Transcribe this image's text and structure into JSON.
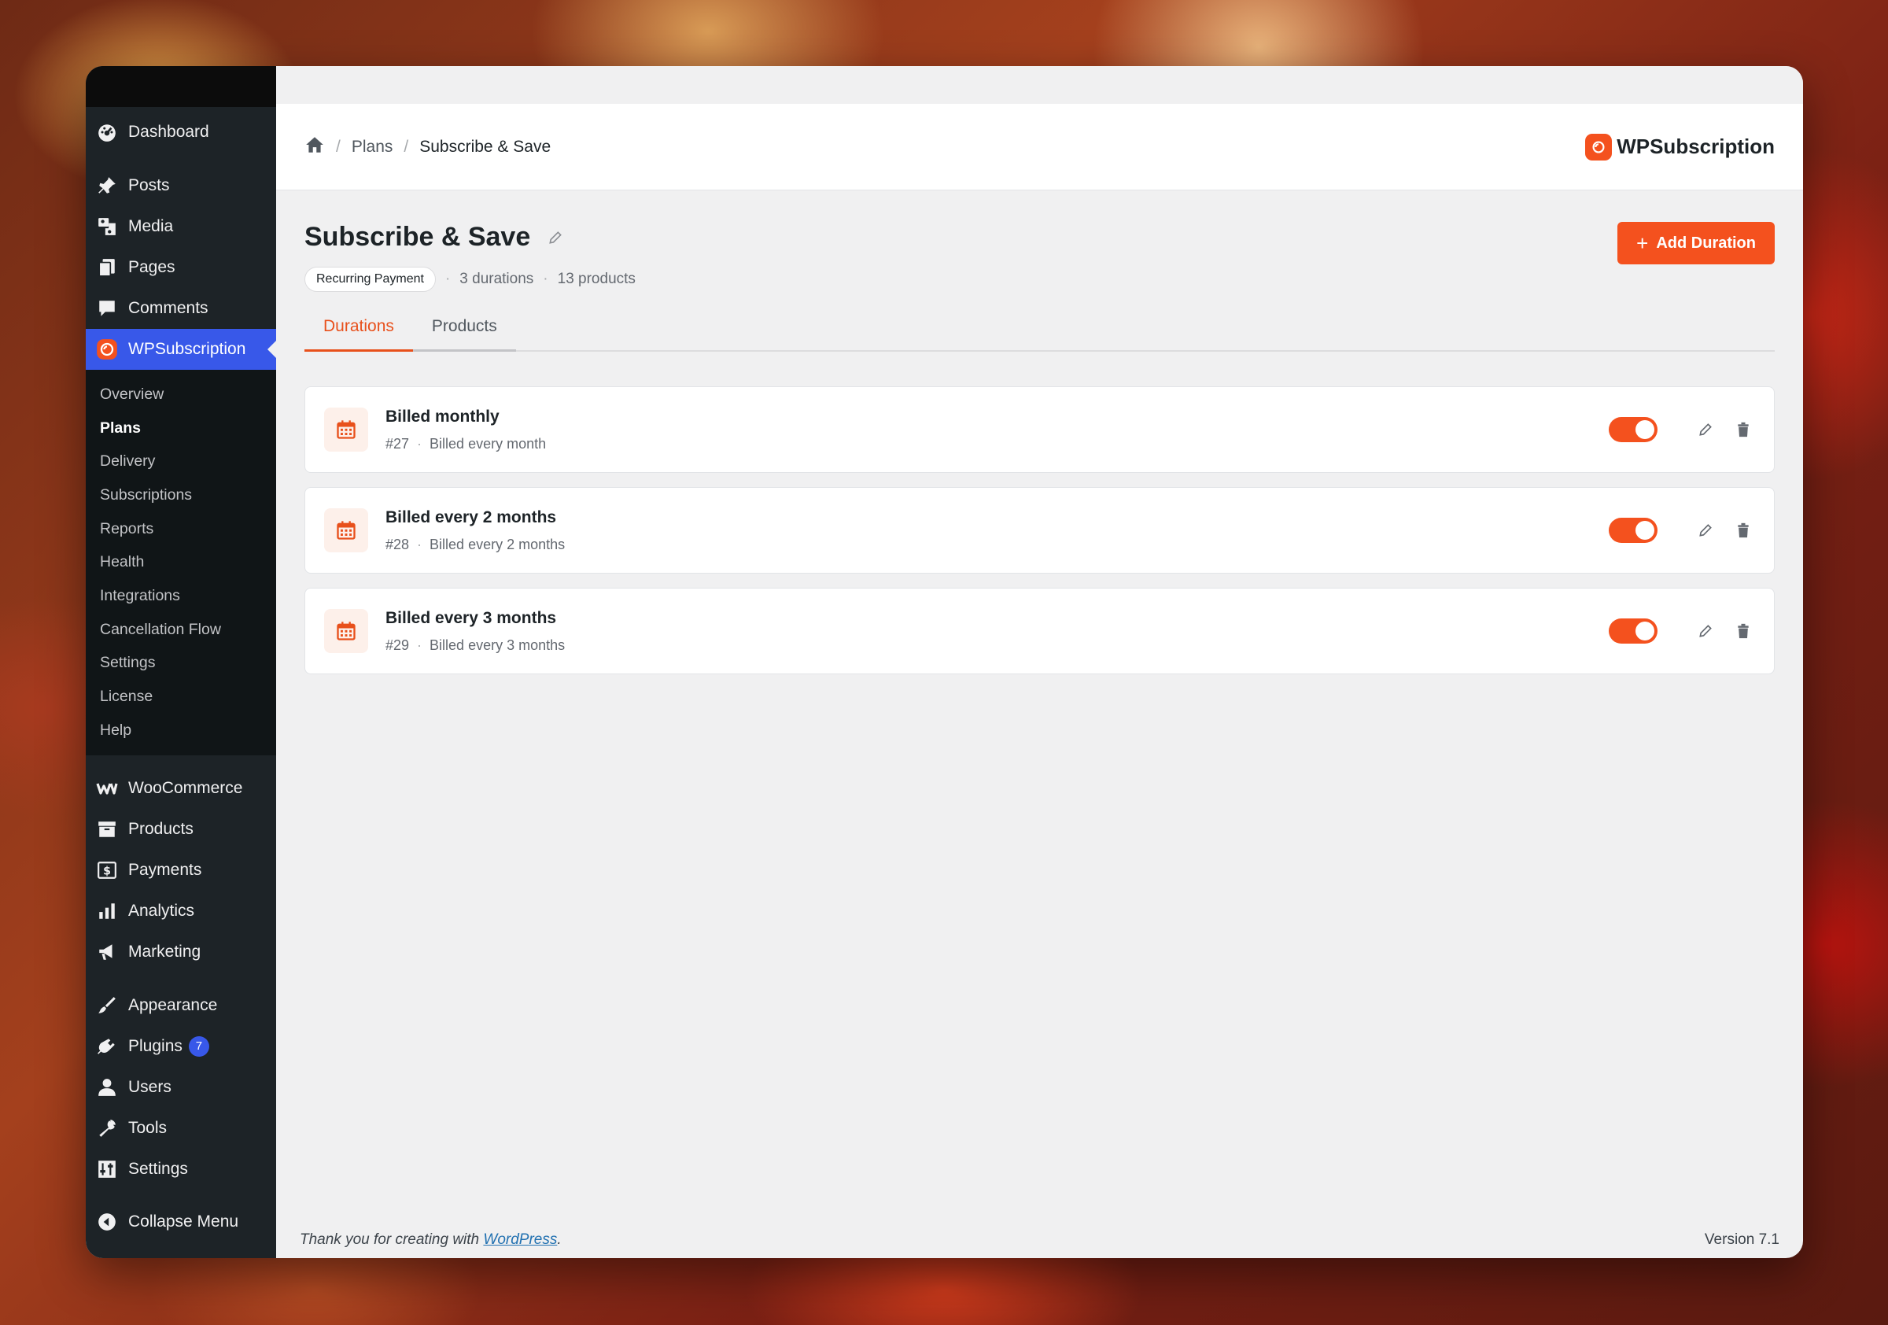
{
  "sidebar": {
    "group1": [
      {
        "label": "Dashboard",
        "icon": "dashboard-icon"
      }
    ],
    "group2": [
      {
        "label": "Posts",
        "icon": "pin-icon"
      },
      {
        "label": "Media",
        "icon": "media-icon"
      },
      {
        "label": "Pages",
        "icon": "pages-icon"
      },
      {
        "label": "Comments",
        "icon": "comments-icon"
      }
    ],
    "active": {
      "label": "WPSubscription",
      "icon": "wpsubscription-icon"
    },
    "submenu": [
      "Overview",
      "Plans",
      "Delivery",
      "Subscriptions",
      "Reports",
      "Health",
      "Integrations",
      "Cancellation Flow",
      "Settings",
      "License",
      "Help"
    ],
    "submenu_current": "Plans",
    "group3": [
      {
        "label": "WooCommerce",
        "icon": "woocommerce-icon"
      },
      {
        "label": "Products",
        "icon": "archive-icon"
      },
      {
        "label": "Payments",
        "icon": "payments-icon"
      },
      {
        "label": "Analytics",
        "icon": "analytics-icon"
      },
      {
        "label": "Marketing",
        "icon": "megaphone-icon"
      }
    ],
    "group4": [
      {
        "label": "Appearance",
        "icon": "paintbrush-icon"
      },
      {
        "label": "Plugins",
        "icon": "plugin-icon",
        "badge": "7"
      },
      {
        "label": "Users",
        "icon": "users-icon"
      },
      {
        "label": "Tools",
        "icon": "wrench-icon"
      },
      {
        "label": "Settings",
        "icon": "settings-icon"
      }
    ],
    "collapse_label": "Collapse Menu"
  },
  "header": {
    "breadcrumb": [
      "Plans",
      "Subscribe & Save"
    ],
    "brand_bold": "WP",
    "brand_rest": "Subscription"
  },
  "page": {
    "title": "Subscribe & Save",
    "pill": "Recurring Payment",
    "durations_count": "3 durations",
    "products_count": "13 products",
    "add_button": "Add Duration",
    "tabs": [
      "Durations",
      "Products"
    ]
  },
  "durations": [
    {
      "title": "Billed monthly",
      "id": "#27",
      "desc": "Billed every month",
      "enabled": true
    },
    {
      "title": "Billed every 2 months",
      "id": "#28",
      "desc": "Billed every 2 months",
      "enabled": true
    },
    {
      "title": "Billed every 3 months",
      "id": "#29",
      "desc": "Billed every 3 months",
      "enabled": true
    }
  ],
  "footer": {
    "thanks_prefix": "Thank you for creating with ",
    "link": "WordPress",
    "thanks_suffix": ".",
    "version": "Version 7.1"
  },
  "colors": {
    "accent": "#f4511e",
    "sidebar": "#1d2327",
    "active": "#3858e9"
  }
}
